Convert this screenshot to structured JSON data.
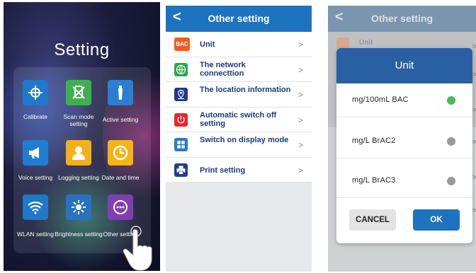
{
  "panel1": {
    "title": "Setting",
    "tiles": [
      {
        "label": "Calibrate",
        "icon": "crosshair-icon",
        "color": "#1f78c8"
      },
      {
        "label": "Scan mode setting",
        "icon": "scan-off-icon",
        "color": "#3fb04f"
      },
      {
        "label": "Active setting",
        "icon": "breath-tube-icon",
        "color": "#2a7fd0"
      },
      {
        "label": "Voice setting",
        "icon": "megaphone-icon",
        "color": "#1f7ed4"
      },
      {
        "label": "Logging setting",
        "icon": "user-icon",
        "color": "#f2b01c"
      },
      {
        "label": "Date and time",
        "icon": "clock-icon",
        "color": "#f4b316"
      },
      {
        "label": "WLAN setting",
        "icon": "wifi-icon",
        "color": "#1f78c8"
      },
      {
        "label": "Brightness setting",
        "icon": "sun-icon",
        "color": "#2a72c0"
      },
      {
        "label": "Other setting",
        "icon": "more-icon",
        "color": "#7f3fb3"
      }
    ]
  },
  "panel2": {
    "back": "<",
    "title": "Other setting",
    "items": [
      {
        "label": "Unit",
        "icon": "bac-icon",
        "icon_text": "BAC",
        "color": "#f25a22"
      },
      {
        "label": "The network connecttion",
        "icon": "globe-icon",
        "color": "#2aa84a"
      },
      {
        "label": "The location information",
        "icon": "location-pin-icon",
        "color": "#26378a"
      },
      {
        "label": "Automatic switch off setting",
        "icon": "power-icon",
        "color": "#e8262d"
      },
      {
        "label": "Switch on display mode",
        "icon": "display-mode-icon",
        "color": "#2a79c9"
      },
      {
        "label": "Print setting",
        "icon": "printer-icon",
        "color": "#1f3f8a"
      }
    ],
    "chevron": ">"
  },
  "panel3": {
    "back": "<",
    "title": "Other setting",
    "underlay_label": "Unit",
    "underlay_icon_text": "BAC",
    "dialog": {
      "title": "Unit",
      "options": [
        {
          "label": "mg/100mL  BAC",
          "selected": true,
          "dot_color": "#3fbf4f"
        },
        {
          "label": "mg/L  BrAC2",
          "selected": false,
          "dot_color": "#9a9a9a"
        },
        {
          "label": "mg/L  BrAC3",
          "selected": false,
          "dot_color": "#9a9a9a"
        }
      ],
      "cancel": "CANCEL",
      "ok": "OK"
    },
    "side_chevron": ">"
  }
}
